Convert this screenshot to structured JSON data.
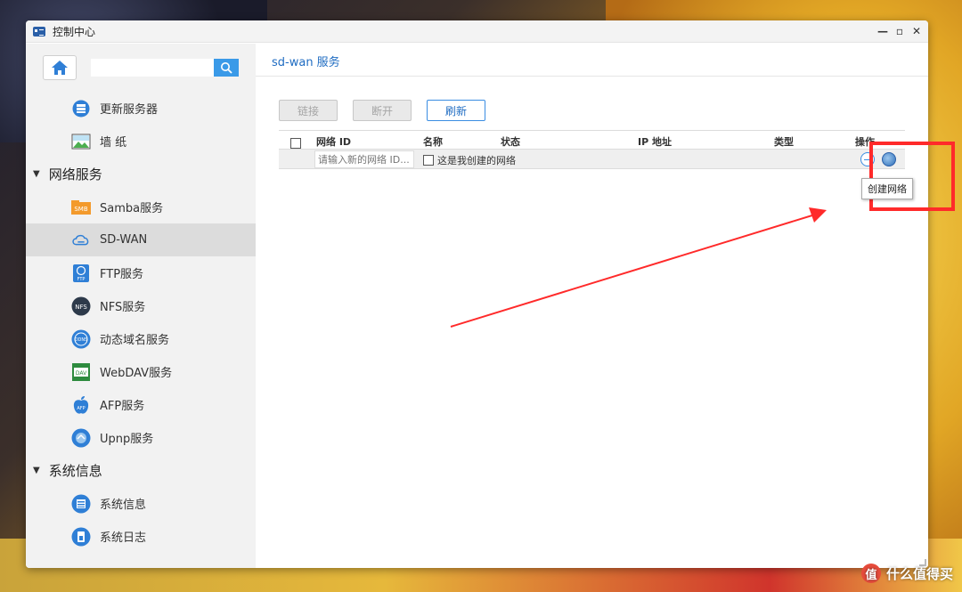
{
  "window": {
    "title": "控制中心",
    "controls": {
      "minimize": "—",
      "maximize": "▫",
      "close": "✕"
    }
  },
  "sidebar": {
    "search_placeholder": "",
    "items": [
      {
        "label": "更新服务器",
        "icon": "update-server-icon"
      },
      {
        "label": "墙 纸",
        "icon": "wallpaper-icon"
      }
    ],
    "groups": [
      {
        "label": "网络服务",
        "items": [
          {
            "label": "Samba服务",
            "icon": "samba-icon",
            "badge": "SMB"
          },
          {
            "label": "SD-WAN",
            "icon": "sdwan-icon",
            "active": true
          },
          {
            "label": "FTP服务",
            "icon": "ftp-icon",
            "badge": "FTP"
          },
          {
            "label": "NFS服务",
            "icon": "nfs-icon",
            "badge": "NFS"
          },
          {
            "label": "动态域名服务",
            "icon": "ddns-icon",
            "badge": "DDNS"
          },
          {
            "label": "WebDAV服务",
            "icon": "webdav-icon",
            "badge": "DAV"
          },
          {
            "label": "AFP服务",
            "icon": "afp-icon",
            "badge": "AFP"
          },
          {
            "label": "Upnp服务",
            "icon": "upnp-icon"
          }
        ]
      },
      {
        "label": "系统信息",
        "items": [
          {
            "label": "系统信息",
            "icon": "system-info-icon"
          },
          {
            "label": "系统日志",
            "icon": "system-log-icon"
          }
        ]
      }
    ]
  },
  "main": {
    "header": "sd-wan 服务",
    "toolbar": {
      "connect": "链接",
      "disconnect": "断开",
      "refresh": "刷新"
    },
    "table": {
      "columns": [
        "网络 ID",
        "名称",
        "状态",
        "IP 地址",
        "类型",
        "操作"
      ],
      "new_row": {
        "input_placeholder": "请输入新的网络 ID...",
        "checkbox_label": "这是我创建的网络"
      }
    },
    "tooltip": "创建网络"
  },
  "watermark": {
    "text": "什么值得买",
    "logo": "值"
  },
  "colors": {
    "accent": "#1f6cc2",
    "highlight": "#ff2a2a",
    "active_item": "#dcdcdc"
  }
}
